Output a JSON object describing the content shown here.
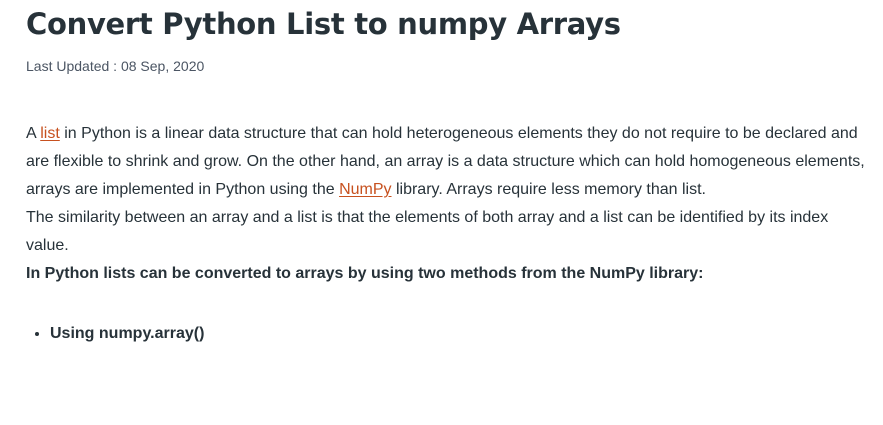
{
  "article": {
    "title": "Convert Python List to numpy Arrays",
    "last_updated_label": "Last Updated",
    "last_updated_sep": " : ",
    "last_updated_date": "08 Sep, 2020",
    "paragraph1": {
      "part1": "A ",
      "link_list": "list",
      "part2": " in Python is a linear data structure that can hold heterogeneous elements they do not require to be declared and are flexible to shrink and grow. On the other hand, an array is a data structure which can hold homogeneous elements, arrays are implemented in Python using the ",
      "link_numpy": "NumPy",
      "part3": " library. Arrays require less memory than list."
    },
    "paragraph2": "The similarity between an array and a list is that the elements of both array and a list can be identified by its index value.",
    "lead": "In Python lists can be converted to arrays by using two methods from the NumPy library:",
    "methods": [
      "Using numpy.array()"
    ]
  },
  "colors": {
    "text": "#273239",
    "link": "#c7511f",
    "meta": "#4b5563"
  }
}
